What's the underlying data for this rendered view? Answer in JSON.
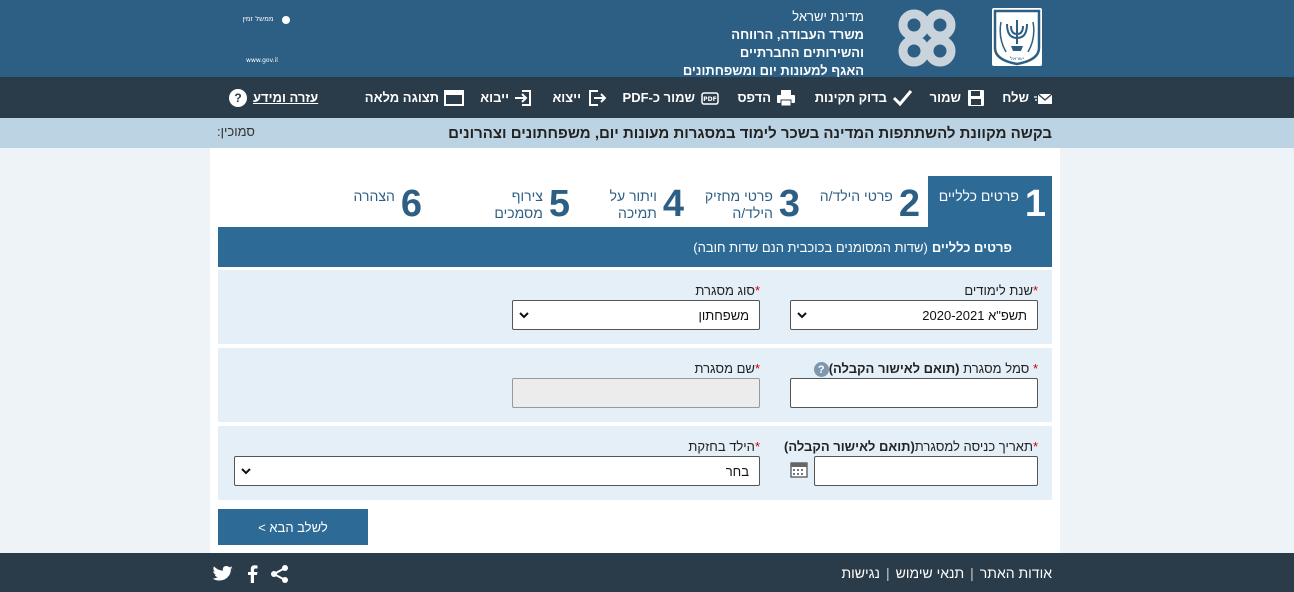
{
  "header": {
    "org_line1": "מדינת ישראל",
    "org_line2": "משרד העבודה, הרווחה",
    "org_line3": "והשירותים החברתיים",
    "org_line4": "האגף למעונות יום ומשפחתונים",
    "emblem_text": "ישראל",
    "gov_logo": "gov",
    "gov_tagline": "ממשל זמין",
    "gov_url": "www.gov.il"
  },
  "toolbar": {
    "send": "שלח",
    "save": "שמור",
    "validate": "בדוק תקינות",
    "print": "הדפס",
    "save_pdf": "שמור כ-PDF",
    "export": "ייצוא",
    "import": "ייבוא",
    "full_view": "תצוגה מלאה",
    "help": "עזרה ומידע"
  },
  "titlebar": {
    "title": "בקשה מקוונת להשתתפות המדינה בשכר לימוד במסגרות מעונות יום, משפחתונים וצהרונים",
    "reference": "סמוכין:"
  },
  "tabs": [
    {
      "num": "1",
      "line1": "פרטים כלליים",
      "line2": ""
    },
    {
      "num": "2",
      "line1": "פרטי הילד/ה",
      "line2": ""
    },
    {
      "num": "3",
      "line1": "פרטי מחזיק",
      "line2": "הילד/ה"
    },
    {
      "num": "4",
      "line1": "ויתור על",
      "line2": "תמיכה"
    },
    {
      "num": "5",
      "line1": "צירוף",
      "line2": "מסמכים"
    },
    {
      "num": "6",
      "line1": "הצהרה",
      "line2": ""
    }
  ],
  "section": {
    "title": "פרטים כלליים",
    "note": "(שדות המסומנים בכוכבית הנם שדות חובה)"
  },
  "form": {
    "req_mark": "*",
    "school_year_label": "שנת לימודים",
    "school_year_value": "תשפ\"א 2020-2021",
    "framework_type_label": "סוג מסגרת",
    "framework_type_value": "משפחתון",
    "framework_code_label": "סמל מסגרת",
    "framework_code_hint": "(תואם לאישור הקבלה)",
    "framework_name_label": "שם מסגרת",
    "entry_date_label": "תאריך כניסה למסגרת",
    "entry_date_hint": "(תואם לאישור הקבלה)",
    "custody_label": "הילד בחזקת",
    "custody_value": "בחר",
    "help_glyph": "?"
  },
  "next_button": "לשלב הבא >",
  "footer": {
    "about": "אודות האתר",
    "terms": "תנאי שימוש",
    "accessibility": "נגישות",
    "separator": "|"
  },
  "colors": {
    "header_bg": "#2d5f85",
    "toolbar_bg": "#2a3b49",
    "accent": "#2d6a95",
    "title_bg": "#bcd3e3",
    "row_bg": "#e4eff7"
  }
}
